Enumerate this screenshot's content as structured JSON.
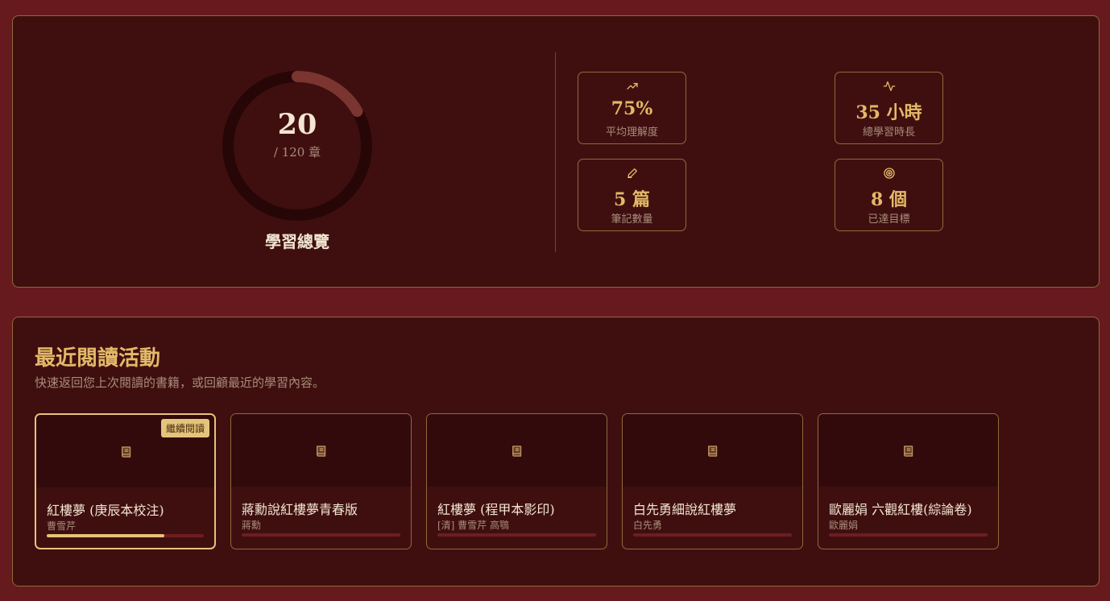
{
  "overview": {
    "chapters_read": "20",
    "chapters_total": "/ 120 章",
    "caption": "學習總覽",
    "progress_fraction": 0.1667,
    "stats": [
      {
        "icon": "trending-up-icon",
        "value": "75%",
        "label": "平均理解度"
      },
      {
        "icon": "activity-icon",
        "value": "35 小時",
        "label": "總學習時長"
      },
      {
        "icon": "pen-icon",
        "value": "5 篇",
        "label": "筆記數量"
      },
      {
        "icon": "target-icon",
        "value": "8 個",
        "label": "已達目標"
      }
    ]
  },
  "activity": {
    "title": "最近閱讀活動",
    "subtitle": "快速返回您上次閱讀的書籍，或回顧最近的學習內容。",
    "continue_label": "繼續閱讀",
    "books": [
      {
        "title": "紅樓夢 (庚辰本校注)",
        "author": "曹雪芹",
        "progress": 0.75,
        "active": true
      },
      {
        "title": "蔣勳說紅樓夢青春版",
        "author": "蔣勳",
        "progress": 0,
        "active": false
      },
      {
        "title": "紅樓夢 (程甲本影印)",
        "author": "[清] 曹雪芹 高鶚",
        "progress": 0,
        "active": false
      },
      {
        "title": "白先勇細說紅樓夢",
        "author": "白先勇",
        "progress": 0,
        "active": false
      },
      {
        "title": "歐麗娟 六觀紅樓(綜論卷)",
        "author": "歐麗娟",
        "progress": 0,
        "active": false
      }
    ]
  },
  "colors": {
    "background": "#671a1d",
    "panel": "#3f0f10",
    "border": "#8f6a3a",
    "accent": "#e4b968",
    "ring": "#7a3530"
  }
}
